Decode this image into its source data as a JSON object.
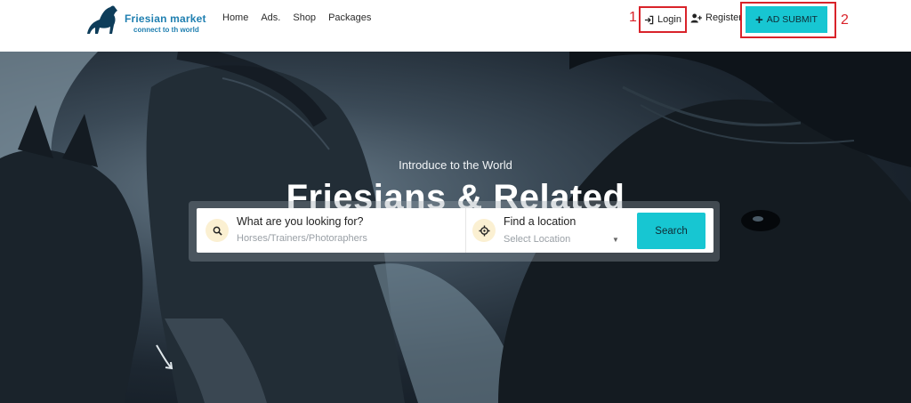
{
  "header": {
    "logo": {
      "title": "Friesian market",
      "tagline": "connect to th world"
    },
    "nav": [
      {
        "label": "Home"
      },
      {
        "label": "Ads."
      },
      {
        "label": "Shop"
      },
      {
        "label": "Packages"
      }
    ],
    "login_label": "Login",
    "register_label": "Register",
    "ad_submit_label": "AD SUBMIT",
    "annotations": [
      "1",
      "2"
    ],
    "accent_color": "#17c6d2",
    "highlight_color": "#d9232a"
  },
  "hero": {
    "subtitle": "Introduce to the World",
    "title": "Friesians & Related",
    "search": {
      "what_label": "What are you looking for?",
      "what_placeholder": "Horses/Trainers/Photoraphers",
      "where_label": "Find a location",
      "where_placeholder": "Select Location",
      "button_label": "Search"
    }
  }
}
